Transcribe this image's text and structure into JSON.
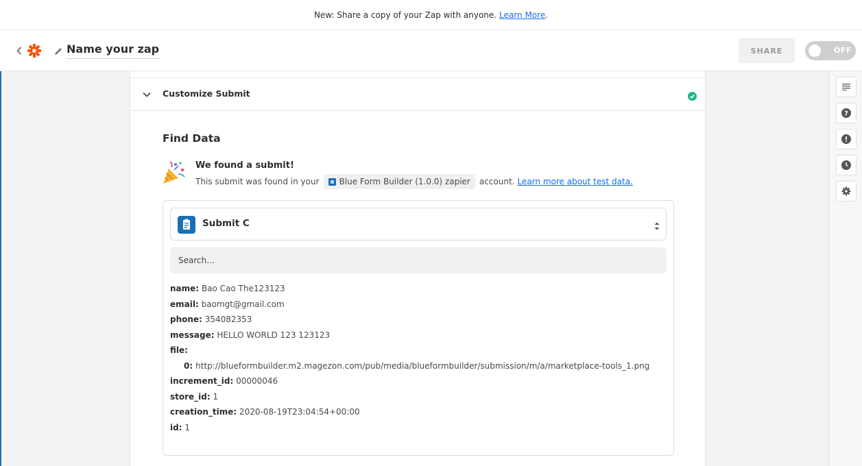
{
  "banner": {
    "text": "New: Share a copy of your Zap with anyone.",
    "link": "Learn More",
    "trail": "."
  },
  "header": {
    "zap_name": "Name your zap",
    "share_label": "SHARE",
    "toggle_label": "OFF"
  },
  "section": {
    "title": "Customize Submit",
    "status": "complete"
  },
  "find": {
    "title": "Find Data",
    "found_title": "We found a submit!",
    "found_prefix": "This submit was found in your",
    "app_name": "Blue Form Builder (1.0.0) zapier",
    "found_suffix": "account.",
    "learn_link": "Learn more about test data."
  },
  "selector": {
    "label": "Submit C"
  },
  "search": {
    "placeholder": "Search..."
  },
  "fields": {
    "name": {
      "key": "name:",
      "value": "Bao Cao The123123"
    },
    "email": {
      "key": "email:",
      "value": "baomgt@gmail.com"
    },
    "phone": {
      "key": "phone:",
      "value": "354082353"
    },
    "message": {
      "key": "message:",
      "value": "HELLO WORLD 123 123123"
    },
    "file": {
      "key": "file:"
    },
    "file_0": {
      "key": "0:",
      "value": "http://blueformbuilder.m2.magezon.com/pub/media/blueformbuilder/submission/m/a/marketplace-tools_1.png"
    },
    "increment_id": {
      "key": "increment_id:",
      "value": "00000046"
    },
    "store_id": {
      "key": "store_id:",
      "value": "1"
    },
    "creation_time": {
      "key": "creation_time:",
      "value": "2020-08-19T23:04:54+00:00"
    },
    "id": {
      "key": "id:",
      "value": "1"
    }
  },
  "rail": {
    "icons": [
      "list-icon",
      "help-icon",
      "alert-icon",
      "history-icon",
      "settings-icon"
    ]
  },
  "colors": {
    "brand_orange": "#ff4f00",
    "link_blue": "#136bf5",
    "success_green": "#1fbb7f",
    "app_blue": "#1a6fb5"
  }
}
